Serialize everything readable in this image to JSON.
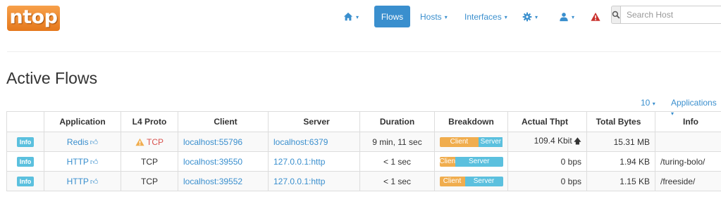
{
  "navbar": {
    "logo_text": "ntop",
    "home_caret": "▾",
    "flows_label": "Flows",
    "hosts_label": "Hosts",
    "interfaces_label": "Interfaces",
    "caret": "▾",
    "search_placeholder": "Search Host",
    "icons": [
      "home-icon",
      "gear-icon",
      "user-icon",
      "alert-icon",
      "search-icon"
    ]
  },
  "page": {
    "title": "Active Flows",
    "per_page": "10",
    "applications_label": "Applications"
  },
  "table": {
    "headers": [
      "",
      "Application",
      "L4 Proto",
      "Client",
      "Server",
      "Duration",
      "Breakdown",
      "Actual Thpt",
      "Total Bytes",
      "Info"
    ],
    "rows": [
      {
        "badge": "Info",
        "application": "Redis",
        "l4_proto": "TCP",
        "proto_warning": true,
        "client": "localhost:55796",
        "server": "localhost:6379",
        "duration": "9 min, 11 sec",
        "breakdown": {
          "client_label": "Client",
          "server_label": "Server",
          "client_pct": 62
        },
        "thpt": "109.4 Kbit",
        "thpt_trend": "up",
        "total_bytes": "15.31 MB",
        "info": ""
      },
      {
        "badge": "Info",
        "application": "HTTP",
        "l4_proto": "TCP",
        "proto_warning": false,
        "client": "localhost:39550",
        "server": "127.0.0.1:http",
        "duration": "< 1 sec",
        "breakdown": {
          "client_label": "Clien",
          "server_label": "Server",
          "client_pct": 25
        },
        "thpt": "0 bps",
        "thpt_trend": "",
        "total_bytes": "1.94 KB",
        "info": "/turing-bolo/"
      },
      {
        "badge": "Info",
        "application": "HTTP",
        "l4_proto": "TCP",
        "proto_warning": false,
        "client": "localhost:39552",
        "server": "127.0.0.1:http",
        "duration": "< 1 sec",
        "breakdown": {
          "client_label": "Client",
          "server_label": "Server",
          "client_pct": 40
        },
        "thpt": "0 bps",
        "thpt_trend": "",
        "total_bytes": "1.15 KB",
        "info": "/freeside/"
      }
    ]
  },
  "colors": {
    "accent": "#3a8fce",
    "client_bar": "#f0ad4e",
    "server_bar": "#5bc0de",
    "warning": "#d9534f",
    "alert_red": "#c9302c"
  }
}
